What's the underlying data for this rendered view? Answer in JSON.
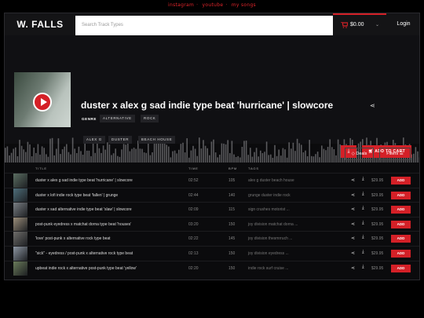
{
  "top_links": [
    "instagram",
    "youtube",
    "my songs"
  ],
  "header": {
    "logo": "W. FALLS",
    "search_placeholder": "Search Track Types",
    "cart_amount": "$0.00",
    "login": "Login"
  },
  "hero": {
    "title": "duster x alex g sad indie type beat 'hurricane' | slowcore",
    "genre_label": "GENRE",
    "genres": [
      "ALTERNATIVE",
      "ROCK"
    ],
    "tags": [
      "ALEX G",
      "DUSTER",
      "BEACH HOUSE"
    ],
    "add_to_cart": "ADD TO CART"
  },
  "toolbar": {
    "deals": "Deals",
    "filters": "Filters"
  },
  "table": {
    "headers": {
      "title": "TITLE",
      "time": "TIME",
      "bpm": "BPM",
      "tags": "TAGS"
    },
    "add_label": "ADD",
    "rows": [
      {
        "title": "duster x alex g sad indie type beat 'hurricane' | slowcore",
        "time": "02:52",
        "bpm": "105",
        "tags": "alex g  duster  beach house",
        "price": "$29.95"
      },
      {
        "title": "duster x lofi indie rock type beat 'fallen' | grunge",
        "time": "02:44",
        "bpm": "140",
        "tags": "grunge  duster  indie rock",
        "price": "$29.95"
      },
      {
        "title": "duster x sad alternative indie type beat 'slaw' | slowcore",
        "time": "02:09",
        "bpm": "115",
        "tags": "sign crushes motorist ...",
        "price": "$29.95"
      },
      {
        "title": "post-punk eyedress x matchat dorna type beat 'houses'",
        "time": "03:20",
        "bpm": "150",
        "tags": "joy division  matchat dorna ...",
        "price": "$29.95"
      },
      {
        "title": "'love' post-punk x alternative rock type beat",
        "time": "02:22",
        "bpm": "145",
        "tags": "joy division  thesmrruch ...",
        "price": "$29.95"
      },
      {
        "title": "\"sick\" - eyedress / post-punk x alternative rock type beat",
        "time": "02:13",
        "bpm": "150",
        "tags": "joy division  eyedress ...",
        "price": "$29.95"
      },
      {
        "title": "upbeat indie rock x alternative post-punk type beat 'yellow'",
        "time": "02:20",
        "bpm": "150",
        "tags": "indie rock  surf cruise ...",
        "price": "$29.95"
      }
    ]
  },
  "colors": {
    "accent": "#d42027",
    "background": "#0b0b0d"
  }
}
